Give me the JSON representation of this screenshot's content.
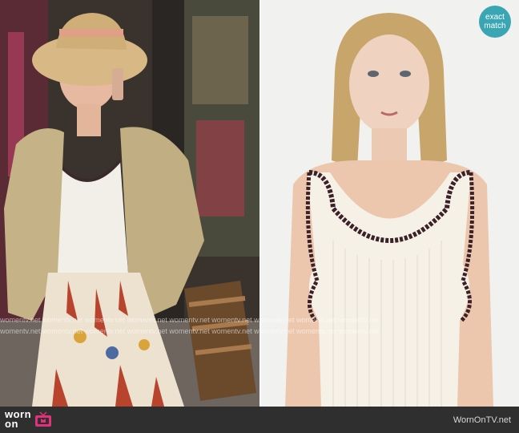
{
  "badge": {
    "line1": "exact",
    "line2": "match"
  },
  "watermark": {
    "row1": "womentv.net   womentv.net   womentv.net   womentv.net   womentv.net   womentv.net   womentv.net   womentv.net   womentv.net",
    "row2": "  womentv.net   womentv.net   womentv.net   womentv.net   womentv.net   womentv.net   womentv.net   womentv.net   womentv.net"
  },
  "footer": {
    "logo_line1": "worn",
    "logo_line2": "on",
    "site": "WornOnTV.net"
  },
  "colors": {
    "footer_bg": "#2f2f2f",
    "badge_bg": "#3aa6b4",
    "brand_pink": "#e0327a"
  }
}
